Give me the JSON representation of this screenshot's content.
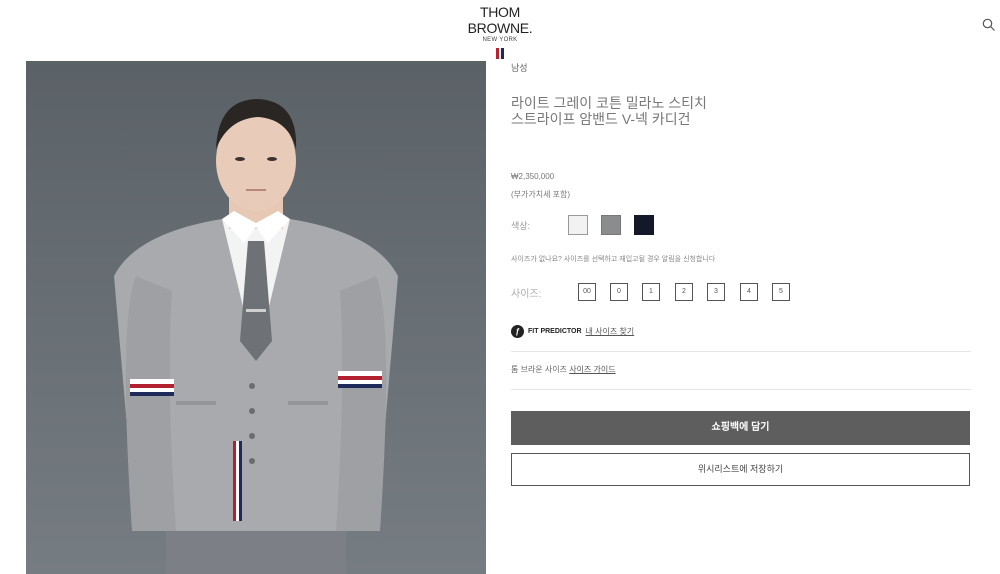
{
  "brand": {
    "name": "THOM BROWNE.",
    "subtitle": "NEW YORK",
    "flag_colors": [
      "#b8232f",
      "#1c2a5a"
    ]
  },
  "header": {
    "search_icon": "search-icon"
  },
  "product": {
    "category": "남성",
    "title": "라이트 그레이 코튼 밀라노 스티치 스트라이프 암밴드 V-넥 카디건",
    "price": "₩2,350,000",
    "vat_note": "(부가가치세 포함)",
    "color_label": "색상:",
    "colors": [
      "#f2f2f2",
      "#8a8c8e",
      "#14192a"
    ],
    "size_note": "사이즈가 없나요? 사이즈를 선택하고 재입고될 경우 알림을 신청합니다",
    "size_label": "사이즈:",
    "sizes": [
      "00",
      "0",
      "1",
      "2",
      "3",
      "4",
      "5"
    ],
    "fit_predictor": {
      "icon": "fit-predictor-icon",
      "label": "FIT PREDICTOR",
      "link": "내 사이즈 찾기"
    },
    "size_guide": {
      "prefix": "톰 브라운 사이즈",
      "link": "사이즈 가이드"
    },
    "add_to_bag": "쇼핑백에 담기",
    "add_to_wishlist": "위시리스트에 저장하기"
  }
}
